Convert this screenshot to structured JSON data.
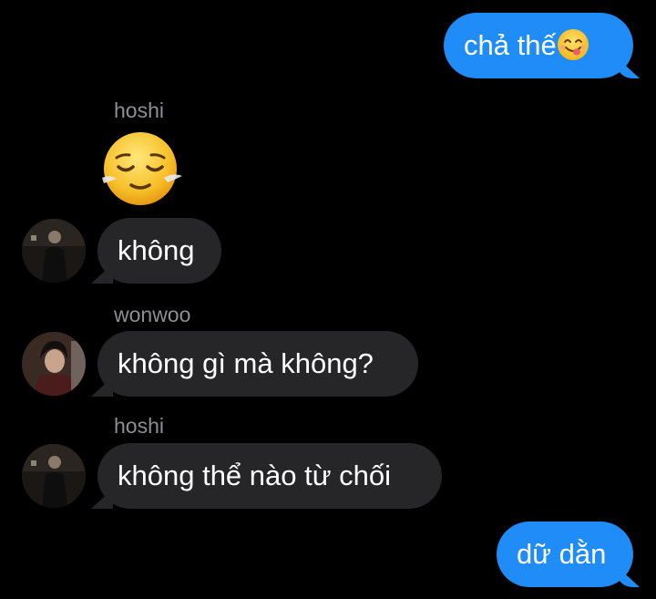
{
  "messages": [
    {
      "id": "m1",
      "direction": "sent",
      "text": "chả thế",
      "emoji": "face-savoring-food"
    },
    {
      "id": "m2",
      "direction": "received",
      "sender": "hoshi",
      "emoji": "relieved-face"
    },
    {
      "id": "m3",
      "direction": "received",
      "text": "không"
    },
    {
      "id": "m4",
      "direction": "received",
      "sender": "wonwoo",
      "text": "không gì mà không?"
    },
    {
      "id": "m5",
      "direction": "received",
      "sender": "hoshi",
      "text": "không thể nào từ chối"
    },
    {
      "id": "m6",
      "direction": "sent",
      "text": "dữ dằn"
    }
  ],
  "colors": {
    "background": "#000000",
    "sent_bubble": "#1f8cf7",
    "received_bubble": "#262629",
    "sender_label": "#8e8e93"
  }
}
